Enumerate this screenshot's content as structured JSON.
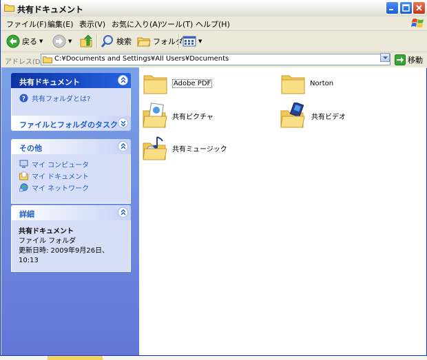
{
  "window": {
    "title": "共有ドキュメント"
  },
  "menu": {
    "items": [
      "ファイル(F)",
      "編集(E)",
      "表示(V)",
      "お気に入り(A)",
      "ツール(T)",
      "ヘルプ(H)"
    ]
  },
  "toolbar": {
    "back_label": "戻る",
    "search_label": "検索",
    "folders_label": "フォルダ"
  },
  "address": {
    "label": "アドレス(D)",
    "value": "C:¥Documents and Settings¥All Users¥Documents",
    "go_label": "移動"
  },
  "left_panels": {
    "shared_docs": {
      "title": "共有ドキュメント",
      "tasks": [
        "共有フォルダとは?"
      ]
    },
    "file_tasks": {
      "title": "ファイルとフォルダのタスク"
    },
    "other": {
      "title": "その他",
      "places": [
        "マイ コンピュータ",
        "マイ ドキュメント",
        "マイ ネットワーク"
      ]
    },
    "details": {
      "title": "詳細",
      "name": "共有ドキュメント",
      "type": "ファイル フォルダ",
      "modified": "更新日時: 2009年9月26日、10:13"
    }
  },
  "folders": [
    {
      "name": "Adobe PDF",
      "icon": "folder-icon"
    },
    {
      "name": "Norton",
      "icon": "folder-icon"
    },
    {
      "name": "共有ピクチャ",
      "icon": "shared-pictures-folder-icon"
    },
    {
      "name": "共有ビデオ",
      "icon": "shared-video-folder-icon"
    },
    {
      "name": "共有ミュージック",
      "icon": "shared-music-folder-icon"
    }
  ],
  "colors": {
    "task_pane_top": "#7BA2E7",
    "task_pane_bottom": "#6375D6",
    "link_blue": "#215DC6",
    "close_red": "#C3351A"
  }
}
